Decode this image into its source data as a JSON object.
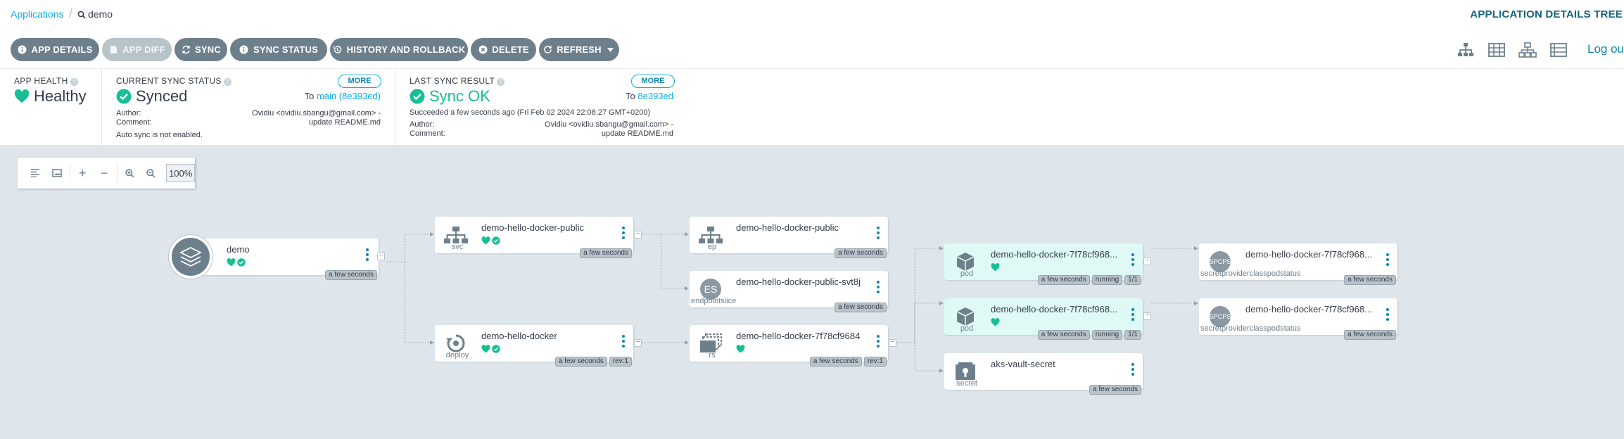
{
  "breadcrumb": {
    "applications": "Applications",
    "current": "demo"
  },
  "page_title": "APPLICATION DETAILS TREE",
  "logout": "Log ou",
  "toolbar": {
    "app_details": "APP DETAILS",
    "app_diff": "APP DIFF",
    "sync": "SYNC",
    "sync_status": "SYNC STATUS",
    "history": "HISTORY AND ROLLBACK",
    "delete": "DELETE",
    "refresh": "REFRESH"
  },
  "app_health": {
    "title": "APP HEALTH",
    "value": "Healthy"
  },
  "current_sync": {
    "title": "CURRENT SYNC STATUS",
    "more": "MORE",
    "value": "Synced",
    "to_label": "To",
    "revision": "main (8e393ed)",
    "author_label": "Author:",
    "author": "Ovidiu <ovidiu.sbangu@gmail.com> -",
    "comment_label": "Comment:",
    "comment": "update README.md",
    "auto_sync": "Auto sync is not enabled."
  },
  "last_sync": {
    "title": "LAST SYNC RESULT",
    "more": "MORE",
    "value": "Sync OK",
    "to_label": "To",
    "revision": "8e393ed",
    "succeeded": "Succeeded a few seconds ago (Fri Feb 02 2024 22:08:27 GMT+0200)",
    "author_label": "Author:",
    "author": "Ovidiu <ovidiu.sbangu@gmail.com> -",
    "comment_label": "Comment:",
    "comment": "update README.md"
  },
  "zoom": {
    "level": "100%"
  },
  "nodes": {
    "root": {
      "name": "demo",
      "age": "a few seconds"
    },
    "svc": {
      "name": "demo-hello-docker-public",
      "kind": "svc",
      "age": "a few seconds"
    },
    "deploy": {
      "name": "demo-hello-docker",
      "kind": "deploy",
      "age": "a few seconds",
      "rev": "rev:1"
    },
    "ep": {
      "name": "demo-hello-docker-public",
      "kind": "ep",
      "age": "a few seconds"
    },
    "eps": {
      "name": "demo-hello-docker-public-svt8j",
      "kind": "endpointslice",
      "badge": "ES",
      "age": "a few seconds"
    },
    "rs": {
      "name": "demo-hello-docker-7f78cf9684",
      "kind": "rs",
      "age": "a few seconds",
      "rev": "rev:1"
    },
    "pod1": {
      "name": "demo-hello-docker-7f78cf968...",
      "kind": "pod",
      "age": "a few seconds",
      "status": "running",
      "ready": "1/1"
    },
    "pod2": {
      "name": "demo-hello-docker-7f78cf968...",
      "kind": "pod",
      "age": "a few seconds",
      "status": "running",
      "ready": "1/1"
    },
    "secret": {
      "name": "aks-vault-secret",
      "kind": "secret",
      "age": "a few seconds"
    },
    "spcps1": {
      "name": "demo-hello-docker-7f78cf968...",
      "kind": "secretproviderclasspodstatus",
      "badge": "SPCPS",
      "age": "a few seconds"
    },
    "spcps2": {
      "name": "demo-hello-docker-7f78cf968...",
      "kind": "secretproviderclasspodstatus",
      "badge": "SPCPS",
      "age": "a few seconds"
    }
  },
  "colors": {
    "healthy": "#18be94",
    "accent": "#0dadea",
    "button": "#6d7f8b",
    "graph_bg": "#dee6eb"
  }
}
